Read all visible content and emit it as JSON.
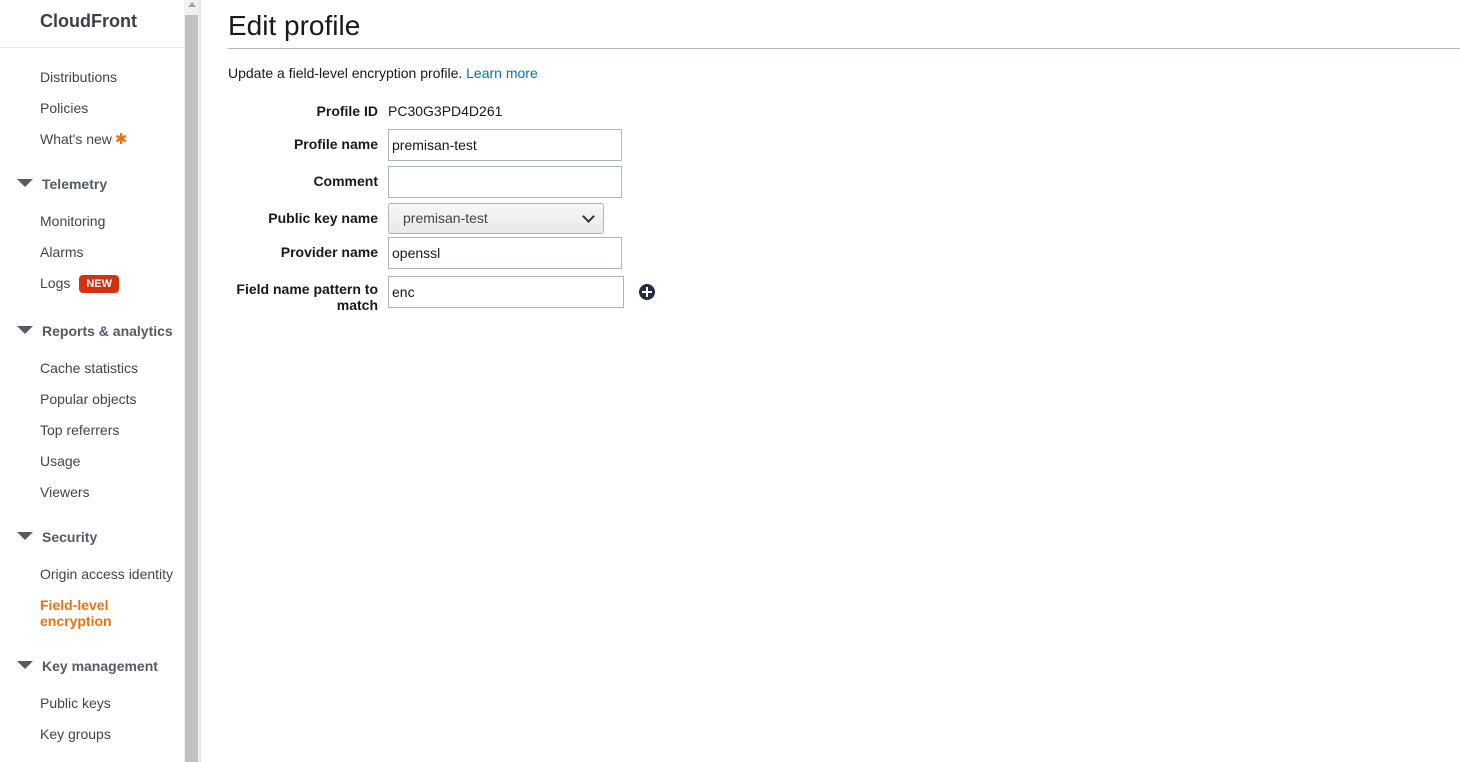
{
  "sidebar": {
    "brand": "CloudFront",
    "top_items": [
      "Distributions",
      "Policies",
      "What's new"
    ],
    "whats_new_marker": "✱",
    "telemetry": {
      "title": "Telemetry",
      "items": [
        "Monitoring",
        "Alarms",
        "Logs"
      ],
      "logs_badge": "NEW"
    },
    "reports": {
      "title": "Reports & analytics",
      "items": [
        "Cache statistics",
        "Popular objects",
        "Top referrers",
        "Usage",
        "Viewers"
      ]
    },
    "security": {
      "title": "Security",
      "items": [
        "Origin access identity",
        "Field-level encryption"
      ]
    },
    "key_management": {
      "title": "Key management",
      "items": [
        "Public keys",
        "Key groups"
      ]
    }
  },
  "page": {
    "title": "Edit profile",
    "description": "Update a field-level encryption profile.",
    "learn_more": "Learn more"
  },
  "form": {
    "profile_id_label": "Profile ID",
    "profile_id_value": "PC30G3PD4D261",
    "profile_name_label": "Profile name",
    "profile_name_value": "premisan-test",
    "comment_label": "Comment",
    "comment_value": "",
    "public_key_label": "Public key name",
    "public_key_value": "premisan-test",
    "provider_label": "Provider name",
    "provider_value": "openssl",
    "pattern_label_line1": "Field name pattern to",
    "pattern_label_line2": "match",
    "pattern_value": "enc"
  },
  "colors": {
    "accent_orange": "#ec7211",
    "link_blue": "#0073bb",
    "badge_red": "#d13212"
  },
  "icons": {
    "add": "plus-circle-icon",
    "section": "caret-down-icon",
    "select": "chevron-down-icon"
  }
}
